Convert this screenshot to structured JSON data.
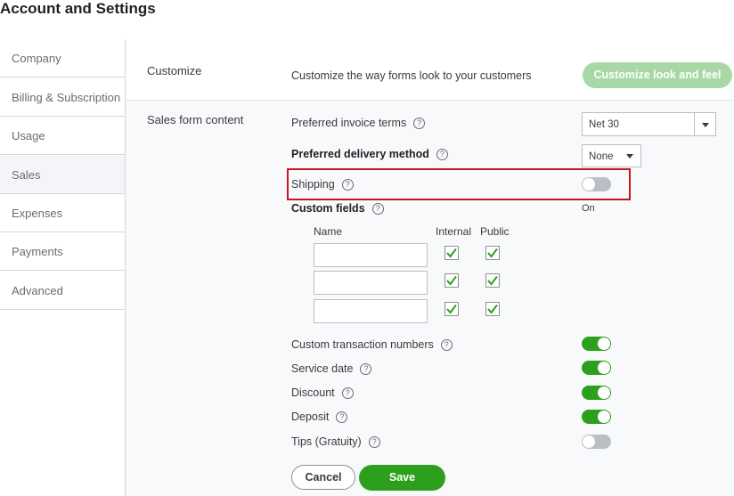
{
  "title": "Account and Settings",
  "sidebar": {
    "items": [
      {
        "label": "Company"
      },
      {
        "label": "Billing & Subscription"
      },
      {
        "label": "Usage"
      },
      {
        "label": "Sales",
        "active": true
      },
      {
        "label": "Expenses"
      },
      {
        "label": "Payments"
      },
      {
        "label": "Advanced"
      }
    ]
  },
  "customize": {
    "section_label": "Customize",
    "description": "Customize the way forms look to your customers",
    "button_label": "Customize look and feel"
  },
  "sales_form": {
    "section_label": "Sales form content",
    "invoice_terms": {
      "label": "Preferred invoice terms",
      "value": "Net 30"
    },
    "delivery_method": {
      "label": "Preferred delivery method",
      "value": "None"
    },
    "shipping": {
      "label": "Shipping",
      "on": false
    },
    "custom_fields": {
      "label": "Custom fields",
      "status": "On",
      "name_header": "Name",
      "internal_header": "Internal",
      "public_header": "Public",
      "rows": [
        {
          "name": "",
          "internal": true,
          "public": true
        },
        {
          "name": "",
          "internal": true,
          "public": true
        },
        {
          "name": "",
          "internal": true,
          "public": true
        }
      ]
    },
    "toggles": [
      {
        "label": "Custom transaction numbers",
        "on": true
      },
      {
        "label": "Service date",
        "on": true
      },
      {
        "label": "Discount",
        "on": true
      },
      {
        "label": "Deposit",
        "on": true
      },
      {
        "label": "Tips (Gratuity)",
        "on": false
      }
    ]
  },
  "help_glyph": "?",
  "actions": {
    "cancel_label": "Cancel",
    "save_label": "Save"
  },
  "colors": {
    "accent": "#2ca01c",
    "accent_light": "#a8d8a6",
    "highlight": "#c8161d"
  }
}
